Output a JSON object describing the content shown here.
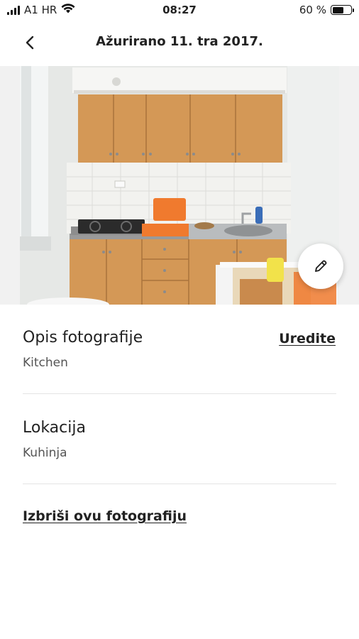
{
  "status_bar": {
    "carrier": "A1 HR",
    "time": "08:27",
    "battery_percent": "60 %",
    "battery_level": 0.6
  },
  "header": {
    "title": "Ažurirano 11. tra 2017.",
    "back_icon": "chevron-left-icon"
  },
  "photo": {
    "edit_icon": "pencil-icon"
  },
  "description": {
    "title": "Opis fotografije",
    "value": "Kitchen",
    "edit_label": "Uredite"
  },
  "location": {
    "title": "Lokacija",
    "value": "Kuhinja"
  },
  "delete_label": "Izbriši ovu fotografiju",
  "colors": {
    "text": "#222222",
    "muted": "#555555",
    "divider": "#e4e4e4"
  }
}
